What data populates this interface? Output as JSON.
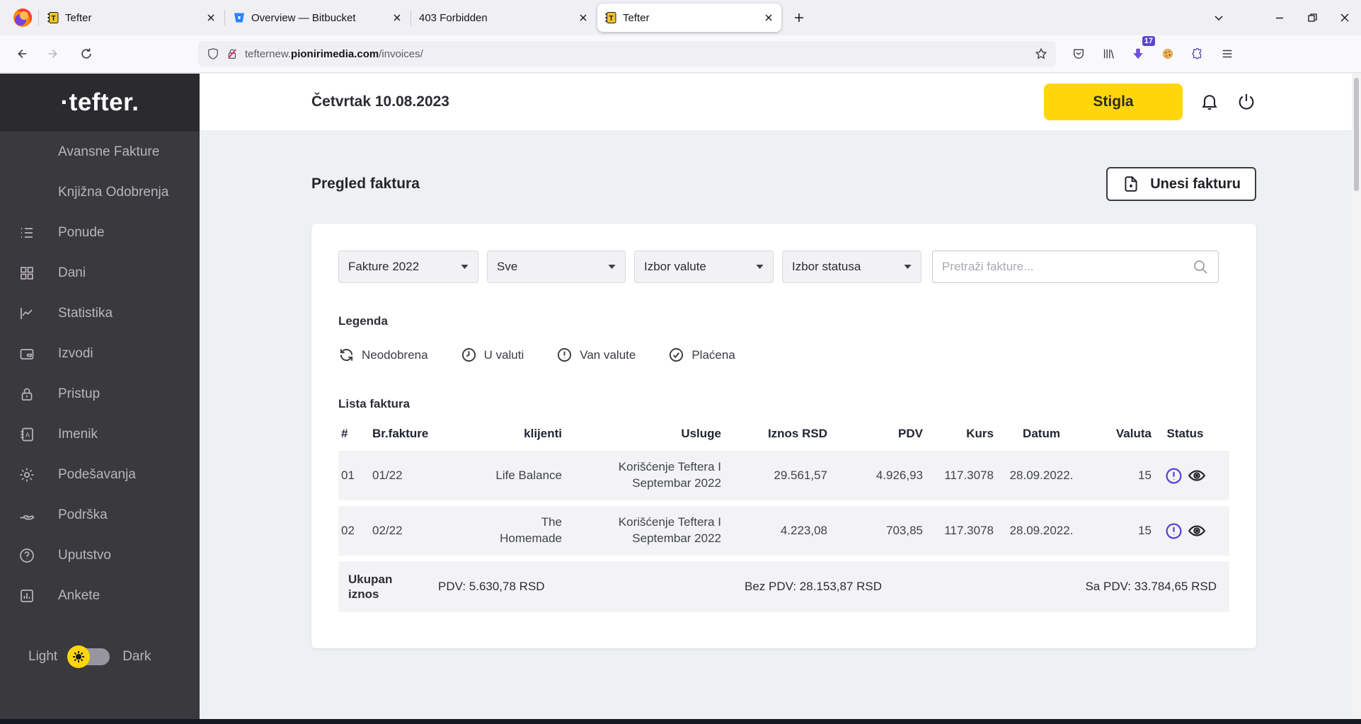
{
  "browser": {
    "tabs": [
      {
        "title": "Tefter"
      },
      {
        "title": "Overview — Bitbucket"
      },
      {
        "title": "403 Forbidden"
      },
      {
        "title": "Tefter"
      }
    ],
    "url": {
      "prefix": "tefternew.",
      "domain": "pionirimedia.com",
      "path": "/invoices/"
    },
    "download_badge": "17"
  },
  "sidebar": {
    "logo": "·tefter.",
    "items": [
      {
        "label": "Avansne Fakture"
      },
      {
        "label": "Knjižna Odobrenja"
      },
      {
        "label": "Ponude"
      },
      {
        "label": "Dani"
      },
      {
        "label": "Statistika"
      },
      {
        "label": "Izvodi"
      },
      {
        "label": "Pristup"
      },
      {
        "label": "Imenik"
      },
      {
        "label": "Podešavanja"
      },
      {
        "label": "Podrška"
      },
      {
        "label": "Uputstvo"
      },
      {
        "label": "Ankete"
      }
    ],
    "theme_toggle": {
      "light": "Light",
      "dark": "Dark"
    }
  },
  "header": {
    "date": "Četvrtak 10.08.2023",
    "status_button": "Stigla"
  },
  "main": {
    "page_title": "Pregled faktura",
    "add_invoice_button": "Unesi fakturu",
    "filters": {
      "year": "Fakture 2022",
      "type": "Sve",
      "currency": "Izbor valute",
      "status": "Izbor statusa",
      "search_placeholder": "Pretraži fakture..."
    },
    "legend": {
      "title": "Legenda",
      "items": [
        {
          "label": "Neodobrena"
        },
        {
          "label": "U valuti"
        },
        {
          "label": "Van valute"
        },
        {
          "label": "Plaćena"
        }
      ]
    },
    "table": {
      "title": "Lista faktura",
      "headers": [
        "#",
        "Br.fakture",
        "klijenti",
        "Usluge",
        "Iznos RSD",
        "PDV",
        "Kurs",
        "Datum",
        "Valuta",
        "Status"
      ],
      "rows": [
        {
          "num": "01",
          "br": "01/22",
          "klijent": "Life Balance",
          "usluge": "Korišćenje Teftera I\nSeptembar 2022",
          "iznos": "29.561,57",
          "pdv": "4.926,93",
          "kurs": "117.3078",
          "datum": "28.09.2022.",
          "valuta": "15"
        },
        {
          "num": "02",
          "br": "02/22",
          "klijent": "The\nHomemade",
          "usluge": "Korišćenje Teftera I\nSeptembar 2022",
          "iznos": "4.223,08",
          "pdv": "703,85",
          "kurs": "117.3078",
          "datum": "28.09.2022.",
          "valuta": "15"
        }
      ],
      "totals": {
        "label": "Ukupan iznos",
        "pdv": "PDV: 5.630,78 RSD",
        "bez_pdv": "Bez PDV: 28.153,87 RSD",
        "sa_pdv": "Sa PDV: 33.784,65 RSD"
      }
    }
  },
  "colors": {
    "accent_yellow": "#ffd60a",
    "status_purple": "#5b43d6",
    "sidebar_dark": "#3a393d"
  }
}
